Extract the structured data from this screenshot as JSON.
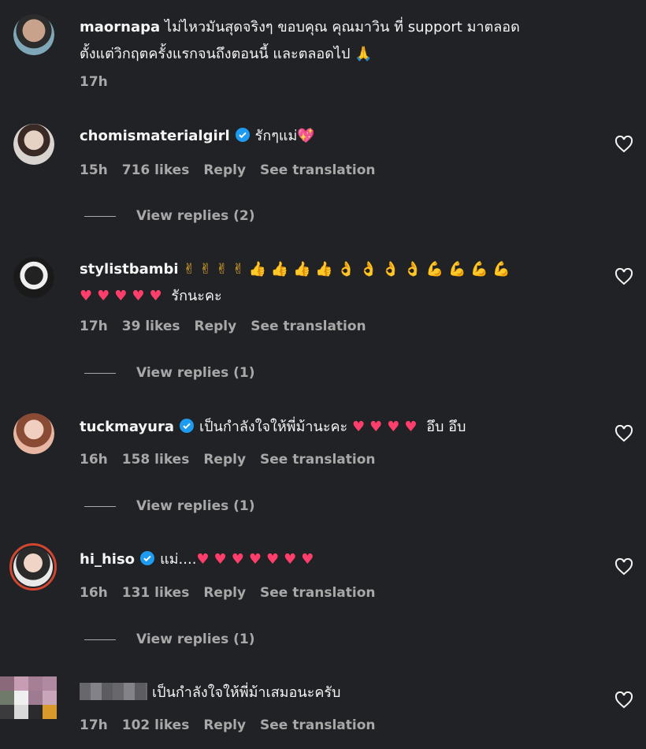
{
  "comments": [
    {
      "user": "maornapa",
      "text": "ไม่ไหวมันสุดจริงๆ ขอบคุณ คุณมาวิน ที่ support มาตลอด",
      "text2": "ตั้งแต่วิกฤตครั้งแรกจนถึงตอนนี้ และตลอดไป 🙏",
      "time": "17h"
    },
    {
      "user": "chomismaterialgirl",
      "text": "รักๆแม่💖",
      "time": "15h",
      "likes": "716 likes",
      "reply": "Reply",
      "translate": "See translation",
      "replies": "View replies (2)"
    },
    {
      "user": "stylistbambi",
      "text": "✌ ✌ ✌ ✌ 👍 👍 👍 👍 👌 👌 👌 👌 💪 💪 💪 💪",
      "text2_hearts": "♥♥♥♥♥",
      "text2": "รักนะคะ",
      "time": "17h",
      "likes": "39 likes",
      "reply": "Reply",
      "translate": "See translation",
      "replies": "View replies (1)"
    },
    {
      "user": "tuckmayura",
      "text": "เป็นกำลังใจให้พี่ม้านะคะ",
      "hearts": "♥♥♥♥",
      "text_after": "อึบ อึบ",
      "time": "16h",
      "likes": "158 likes",
      "reply": "Reply",
      "translate": "See translation",
      "replies": "View replies (1)"
    },
    {
      "user": "hi_hiso",
      "text": "แม่....",
      "hearts": "♥♥♥♥♥♥♥",
      "time": "16h",
      "likes": "131 likes",
      "reply": "Reply",
      "translate": "See translation",
      "replies": "View replies (1)"
    },
    {
      "text": "เป็นกำลังใจให้พี่ม้าเสมอนะครับ",
      "time": "17h",
      "likes": "102 likes",
      "reply": "Reply",
      "translate": "See translation"
    }
  ],
  "colors": {
    "background": "#212226",
    "secondary_text": "#a8a8a8",
    "verified": "#1d9bf0",
    "heart": "#ff3e6c"
  }
}
